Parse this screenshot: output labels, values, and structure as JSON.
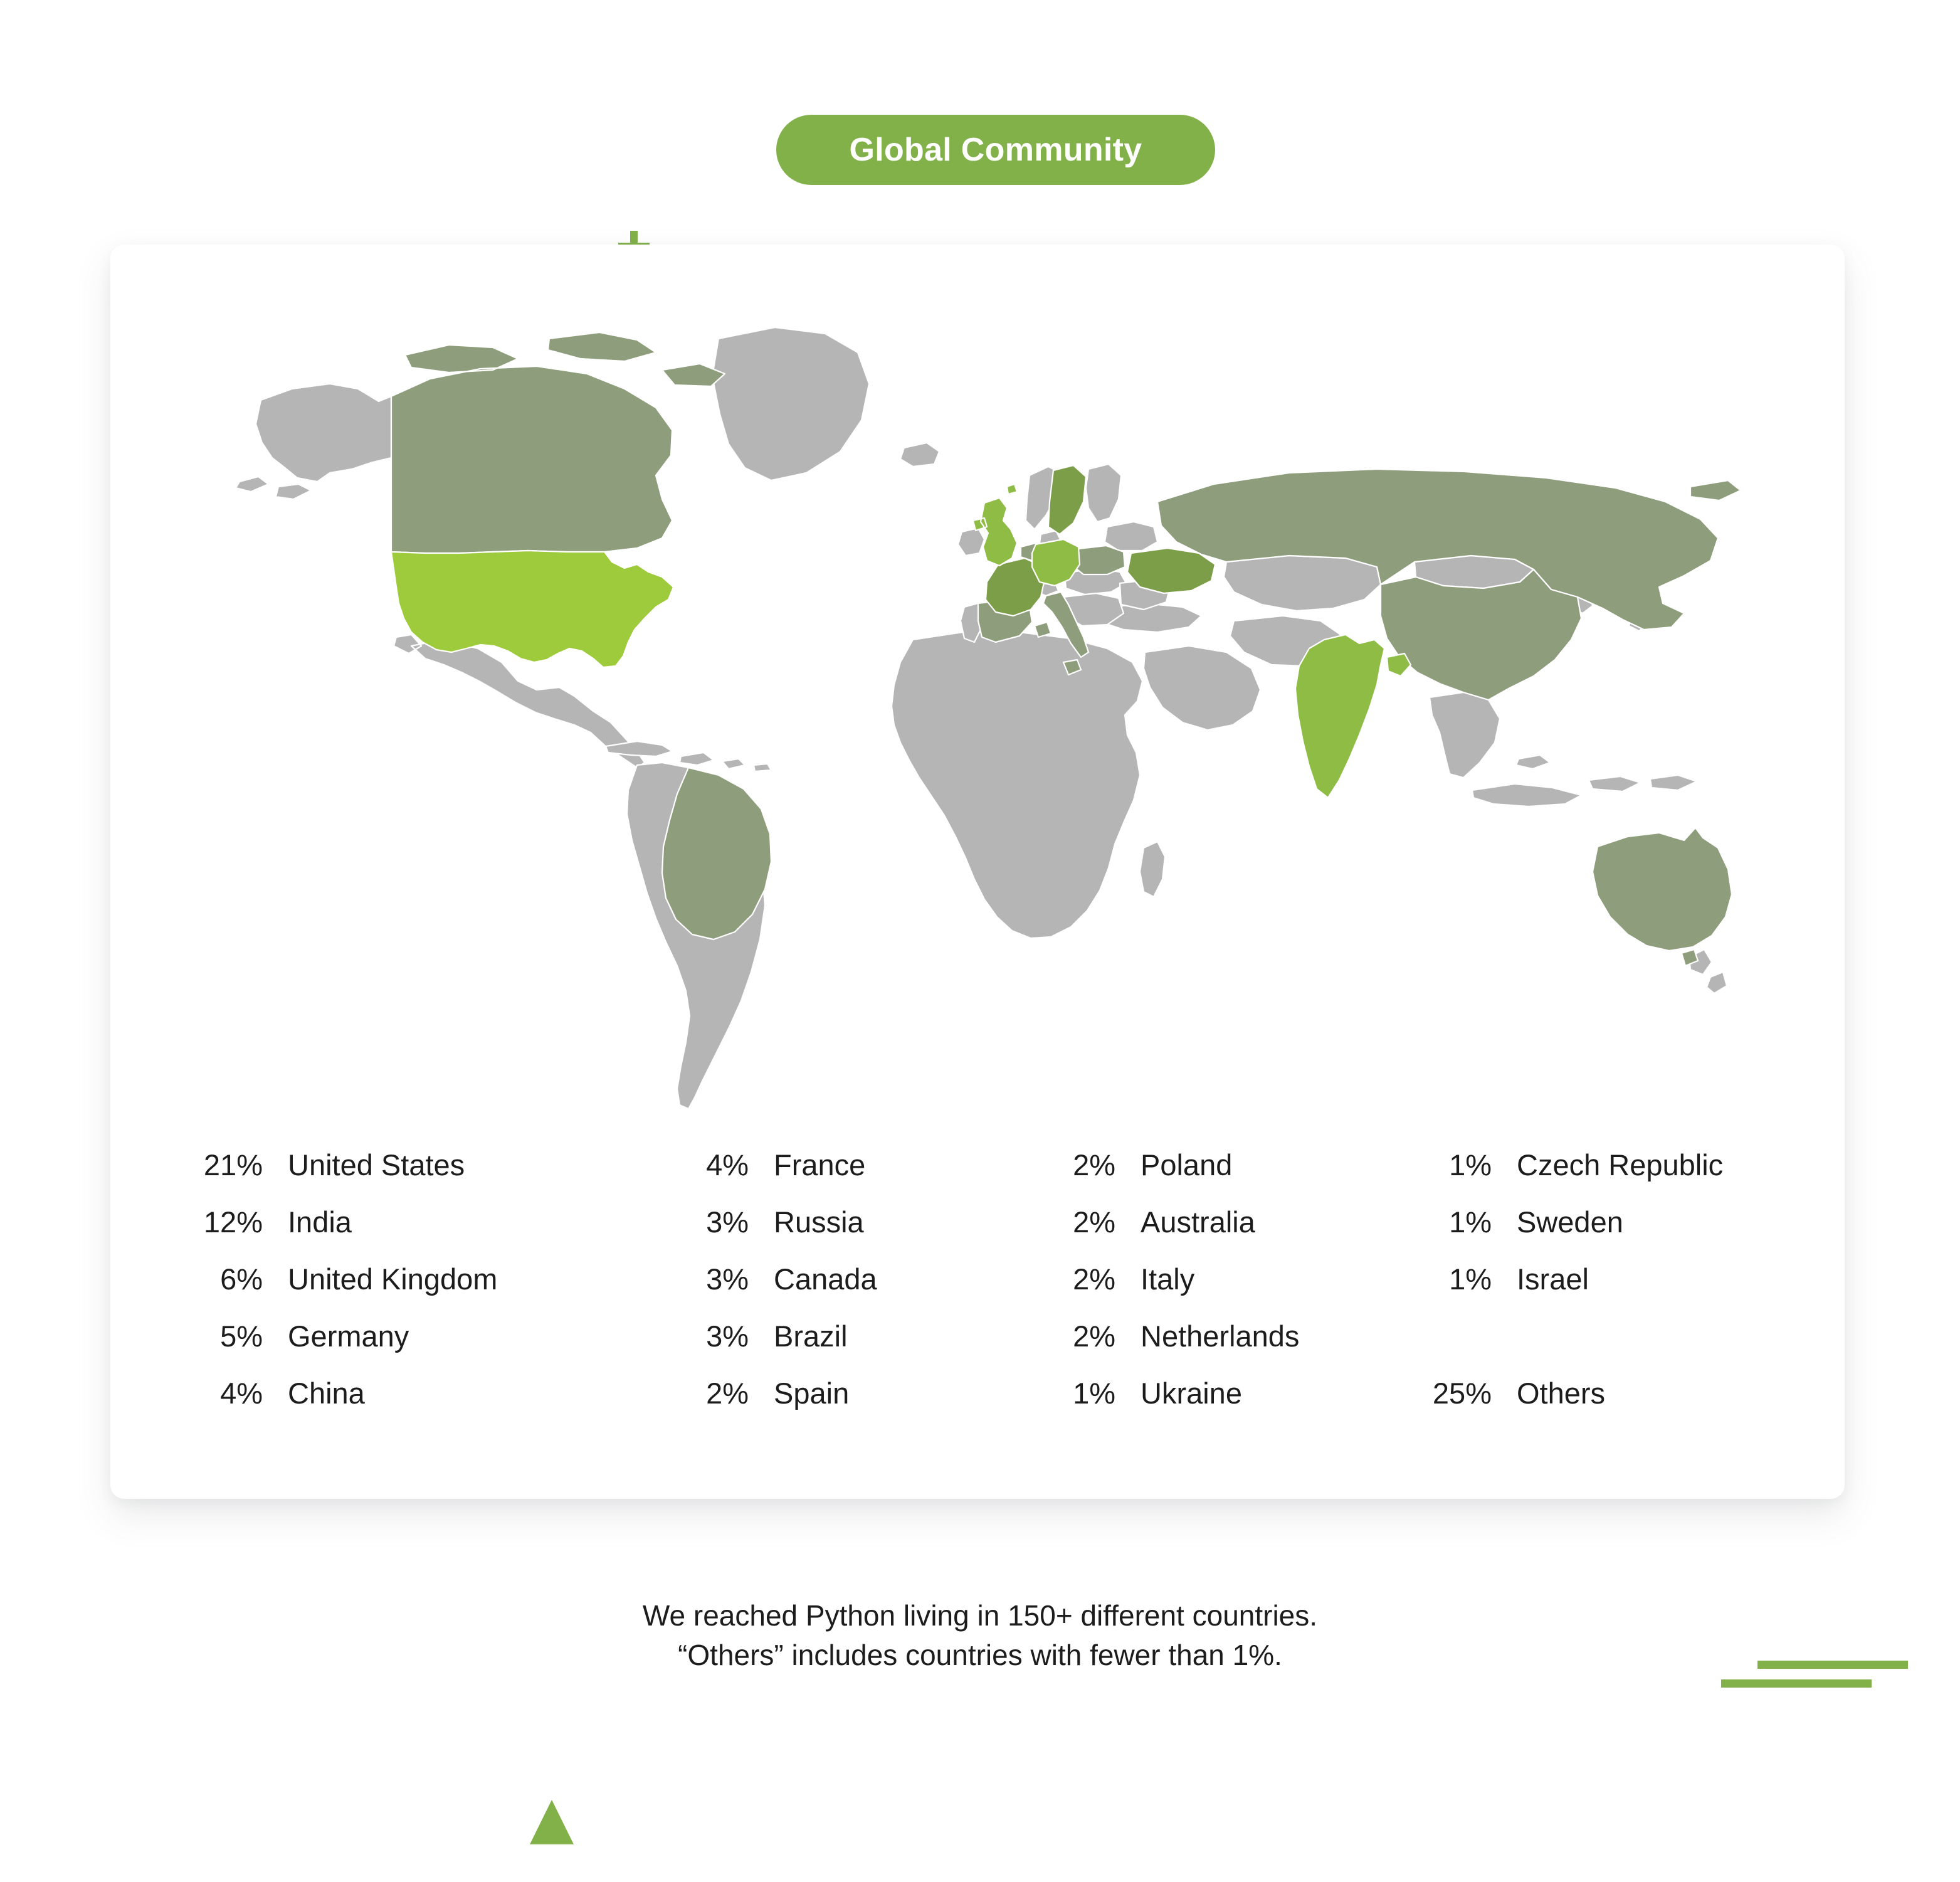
{
  "title_badge": {
    "label": "Global Community",
    "background_color": "#82b14a",
    "text_color": "#ffffff"
  },
  "footer": {
    "line1": "We reached Python living in 150+ different countries.",
    "line2": "“Others” includes countries with fewer than 1%."
  },
  "decorations": {
    "plus_icon": "plus-icon",
    "cube_icon": "cube-outline-icon",
    "lines_icon": "double-line-icon",
    "triangle_icon": "triangle-icon",
    "accent_color": "#82b14a"
  },
  "map": {
    "base_country_color": "#b5b5b5",
    "border_color": "#ffffff",
    "tier_colors": {
      "tier1": "#9ecb3c",
      "tier2": "#8fbc45",
      "tier3": "#7d9e49",
      "tier4": "#8e9e7c"
    }
  },
  "chart_data": {
    "type": "map",
    "title": "Global Community",
    "subtitle": "We reached Python living in 150+ different countries.",
    "unit": "%",
    "categories": [
      "United States",
      "India",
      "United Kingdom",
      "Germany",
      "China",
      "France",
      "Russia",
      "Canada",
      "Brazil",
      "Spain",
      "Poland",
      "Australia",
      "Italy",
      "Netherlands",
      "Ukraine",
      "Czech Republic",
      "Sweden",
      "Israel",
      "Others"
    ],
    "values": [
      21,
      12,
      6,
      5,
      4,
      4,
      3,
      3,
      3,
      2,
      2,
      2,
      2,
      2,
      1,
      1,
      1,
      1,
      25
    ],
    "annotations": [
      "“Others” includes countries with fewer than 1%."
    ]
  },
  "legend": {
    "columns": [
      {
        "rows": [
          {
            "pct": "21%",
            "country": "United States"
          },
          {
            "pct": "12%",
            "country": "India"
          },
          {
            "pct": "6%",
            "country": "United Kingdom"
          },
          {
            "pct": "5%",
            "country": "Germany"
          },
          {
            "pct": "4%",
            "country": "China"
          }
        ]
      },
      {
        "rows": [
          {
            "pct": "4%",
            "country": "France"
          },
          {
            "pct": "3%",
            "country": "Russia"
          },
          {
            "pct": "3%",
            "country": "Canada"
          },
          {
            "pct": "3%",
            "country": "Brazil"
          },
          {
            "pct": "2%",
            "country": "Spain"
          }
        ]
      },
      {
        "rows": [
          {
            "pct": "2%",
            "country": "Poland"
          },
          {
            "pct": "2%",
            "country": "Australia"
          },
          {
            "pct": "2%",
            "country": "Italy"
          },
          {
            "pct": "2%",
            "country": "Netherlands"
          },
          {
            "pct": "1%",
            "country": "Ukraine"
          }
        ]
      },
      {
        "rows": [
          {
            "pct": "1%",
            "country": "Czech Republic"
          },
          {
            "pct": "1%",
            "country": "Sweden"
          },
          {
            "pct": "1%",
            "country": "Israel"
          },
          {
            "pct": "",
            "country": ""
          },
          {
            "pct": "25%",
            "country": "Others"
          }
        ]
      }
    ]
  }
}
